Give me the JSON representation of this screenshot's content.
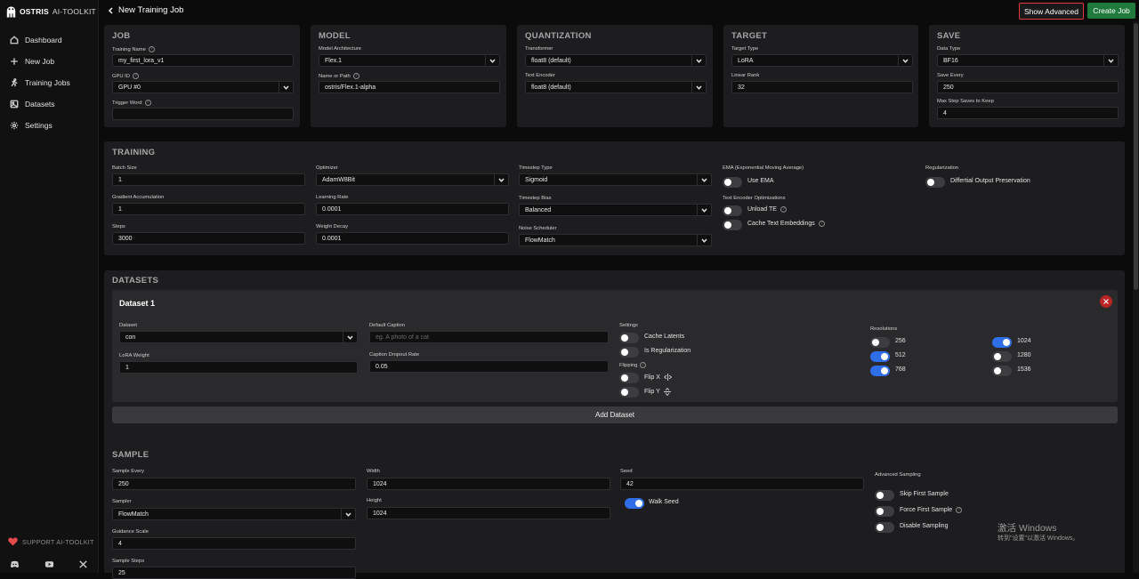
{
  "brand": {
    "name": "OSTRIS",
    "sub": "AI-TOOLKIT"
  },
  "sidebar": {
    "items": [
      {
        "label": "Dashboard",
        "icon": "home-icon"
      },
      {
        "label": "New Job",
        "icon": "plus-icon"
      },
      {
        "label": "Training Jobs",
        "icon": "run-icon"
      },
      {
        "label": "Datasets",
        "icon": "images-icon"
      },
      {
        "label": "Settings",
        "icon": "gear-icon"
      }
    ],
    "support": "SUPPORT AI-TOOLKIT",
    "socials": [
      "discord-icon",
      "youtube-icon",
      "x-icon"
    ]
  },
  "header": {
    "title": "New Training Job",
    "show_advanced": "Show Advanced",
    "create_job": "Create Job"
  },
  "job": {
    "title": "JOB",
    "training_name_label": "Training Name",
    "training_name": "my_first_lora_v1",
    "gpu_label": "GPU ID",
    "gpu": "GPU #0",
    "trigger_label": "Trigger Word",
    "trigger": ""
  },
  "model": {
    "title": "MODEL",
    "arch_label": "Model Architecture",
    "arch": "Flex.1",
    "path_label": "Name or Path",
    "path": "ostris/Flex.1-alpha"
  },
  "quantization": {
    "title": "QUANTIZATION",
    "transformer_label": "Transformer",
    "transformer": "float8 (default)",
    "te_label": "Text Encoder",
    "te": "float8 (default)"
  },
  "target": {
    "title": "TARGET",
    "type_label": "Target Type",
    "type": "LoRA",
    "rank_label": "Linear Rank",
    "rank": "32"
  },
  "save": {
    "title": "SAVE",
    "dtype_label": "Data Type",
    "dtype": "BF16",
    "every_label": "Save Every",
    "every": "250",
    "max_label": "Max Step Saves to Keep",
    "max": "4"
  },
  "training": {
    "title": "TRAINING",
    "batch_label": "Batch Size",
    "batch": "1",
    "grad_label": "Gradient Accumulation",
    "grad": "1",
    "steps_label": "Steps",
    "steps": "3000",
    "optimizer_label": "Optimizer",
    "optimizer": "AdamW8Bit",
    "lr_label": "Learning Rate",
    "lr": "0.0001",
    "wd_label": "Weight Decay",
    "wd": "0.0001",
    "ts_type_label": "Timestep Type",
    "ts_type": "Sigmoid",
    "ts_bias_label": "Timestep Bias",
    "ts_bias": "Balanced",
    "noise_label": "Noise Scheduler",
    "noise": "FlowMatch",
    "ema_label": "EMA (Exponential Moving Average)",
    "use_ema": "Use EMA",
    "teo_label": "Text Encoder Optimizations",
    "unload_te": "Unload TE",
    "cache_te": "Cache Text Embeddings",
    "reg_label": "Regularization",
    "dop": "Differtial Output Preservation"
  },
  "datasets": {
    "title": "DATASETS",
    "dataset_title": "Dataset 1",
    "dataset_label": "Dataset",
    "dataset": "con",
    "lora_weight_label": "LoRA Weight",
    "lora_weight": "1",
    "caption_label": "Default Caption",
    "caption_placeholder": "eg. A photo of a cat",
    "dropout_label": "Caption Dropout Rate",
    "dropout": "0.05",
    "settings_label": "Settings",
    "cache_latents": "Cache Latents",
    "is_reg": "Is Regularization",
    "flipping_label": "Flipping",
    "flip_x": "Flip X",
    "flip_y": "Flip Y",
    "resolutions_label": "Resolutions",
    "resolutions": [
      {
        "value": "256",
        "on": false
      },
      {
        "value": "512",
        "on": true
      },
      {
        "value": "768",
        "on": true
      },
      {
        "value": "1024",
        "on": true
      },
      {
        "value": "1280",
        "on": false
      },
      {
        "value": "1536",
        "on": false
      }
    ],
    "add_dataset": "Add Dataset"
  },
  "sample": {
    "title": "SAMPLE",
    "every_label": "Sample Every",
    "every": "250",
    "sampler_label": "Sampler",
    "sampler": "FlowMatch",
    "guidance_label": "Guidance Scale",
    "guidance": "4",
    "steps_label": "Sample Steps",
    "steps": "25",
    "width_label": "Width",
    "width": "1024",
    "height_label": "Height",
    "height": "1024",
    "seed_label": "Seed",
    "seed": "42",
    "walk_seed": "Walk Seed",
    "adv_label": "Advanced Sampling",
    "skip_first": "Skip First Sample",
    "force_first": "Force First Sample",
    "disable": "Disable Sampling"
  },
  "watermark": {
    "line1": "激活 Windows",
    "line2": "转到\"设置\"以激活 Windows。"
  },
  "colors": {
    "accent": "#2f6ee6",
    "create": "#1f7a3c",
    "highlight": "#e23b3b",
    "card": "#1d1d1f"
  }
}
